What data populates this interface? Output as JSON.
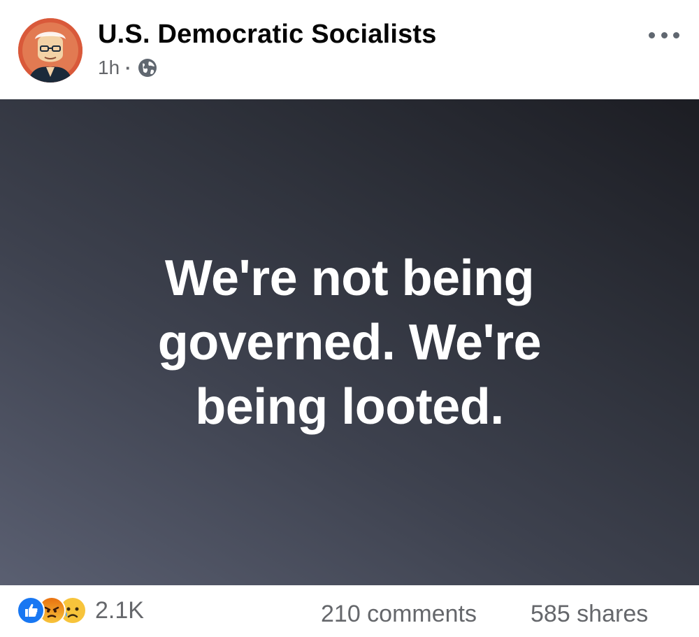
{
  "post": {
    "page_name": "U.S. Democratic Socialists",
    "time": "1h",
    "separator": "·",
    "audience_icon": "globe-icon",
    "menu_icon": "more-options-icon",
    "avatar_icon": "portrait-avatar",
    "quote": "We're not being governed. We're being looted."
  },
  "footer": {
    "reaction_icons": [
      "like-icon",
      "angry-icon",
      "sad-icon"
    ],
    "reaction_count": "2.1K",
    "comments": "210 comments",
    "shares": "585 shares"
  },
  "colors": {
    "avatar_bg": "#d9593a",
    "like": "#1877f2",
    "meta_text": "#65676b",
    "image_dark": "#1c1d23",
    "image_light": "#5a5f71"
  }
}
